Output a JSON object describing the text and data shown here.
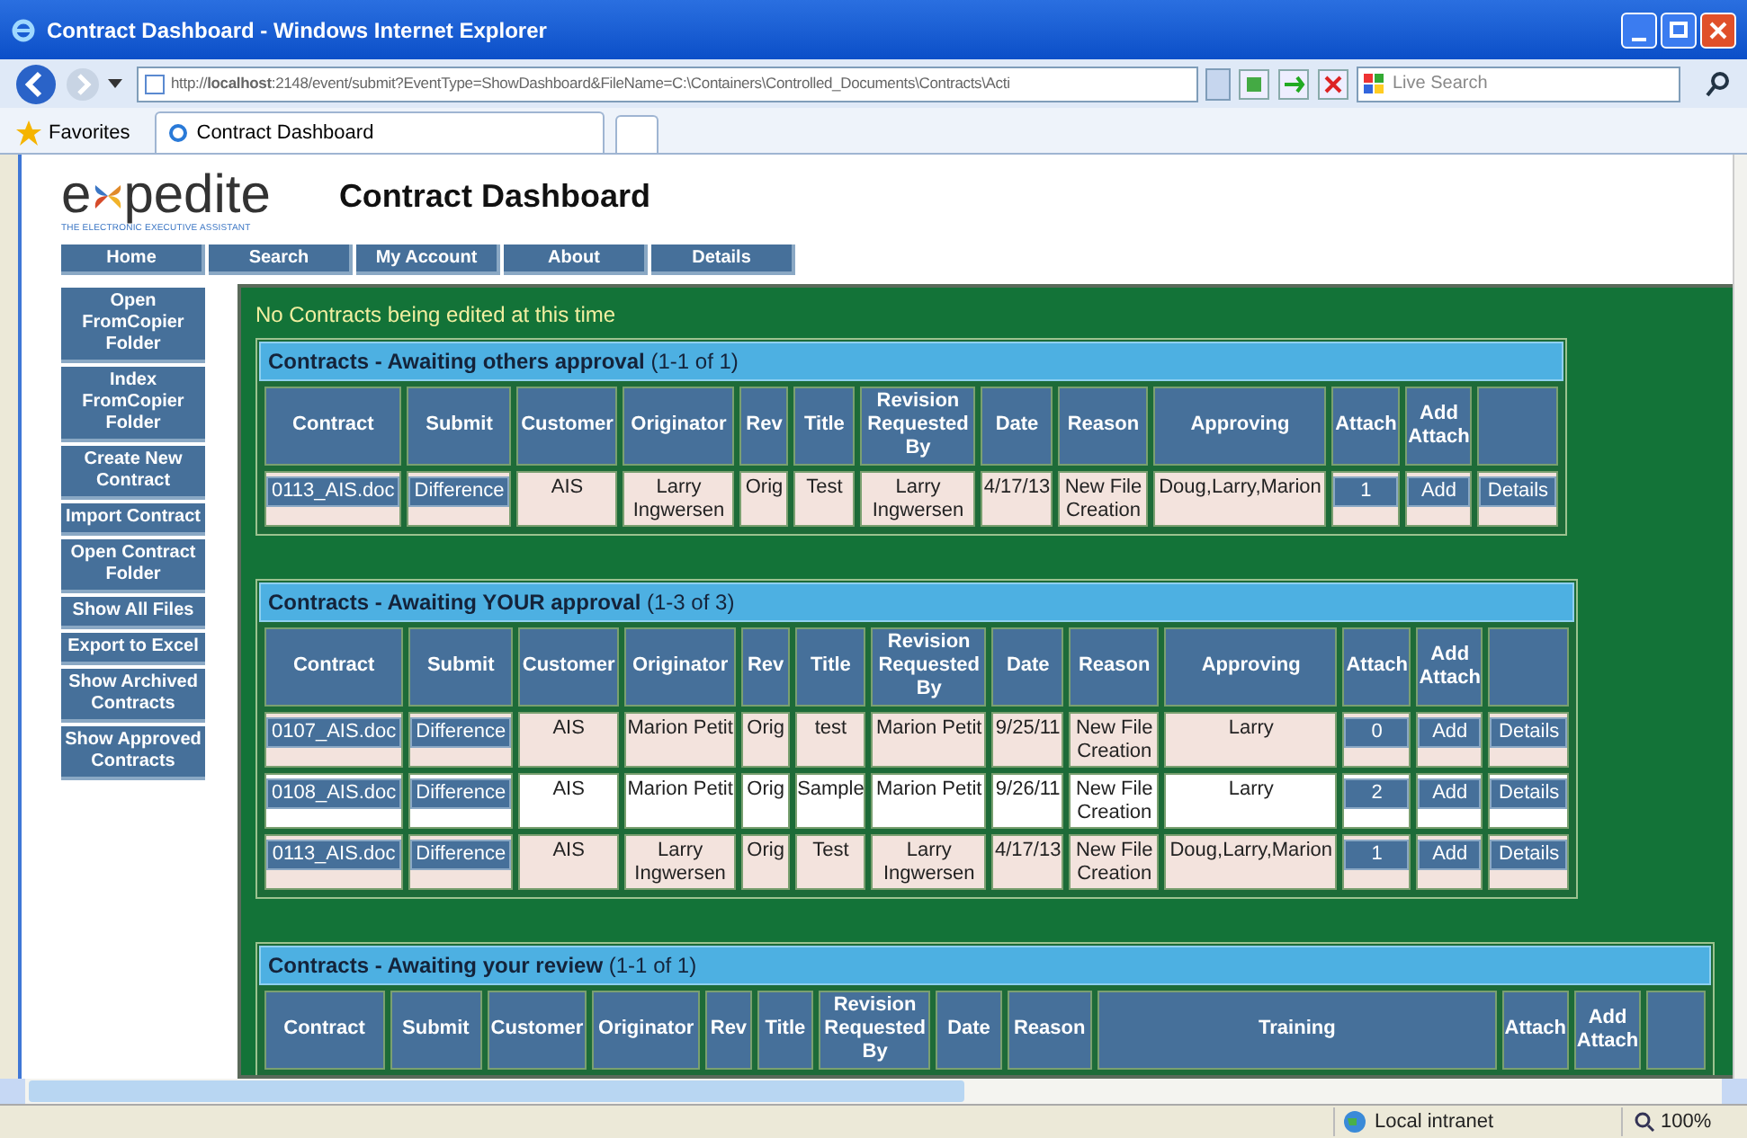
{
  "window": {
    "title": "Contract Dashboard - Windows Internet Explorer"
  },
  "address_bar": {
    "url": "http://**localhost**:2148/event/submit?EventType=ShowDashboard&FileName=C:\\Containers\\Controlled_Documents\\Contracts\\Acti",
    "search_placeholder": "Live Search"
  },
  "favorites": {
    "label": "Favorites"
  },
  "tabs": [
    {
      "label": "Contract Dashboard",
      "selected": true
    }
  ],
  "logo": {
    "before": "e",
    "after": "pedite",
    "tagline": "THE ELECTRONIC EXECUTIVE ASSISTANT"
  },
  "page_title": "Contract Dashboard",
  "nav": [
    "Home",
    "Search",
    "My Account",
    "About",
    "Details"
  ],
  "sidebar": [
    "Open FromCopier Folder",
    "Index FromCopier Folder",
    "Create New Contract",
    "Import Contract",
    "Open Contract Folder",
    "Show All Files",
    "Export to Excel",
    "Show Archived Contracts",
    "Show Approved Contracts"
  ],
  "message": "No Contracts being edited at this time",
  "sections": [
    {
      "title": "Contracts - Awaiting others approval",
      "count": "(1-1 of 1)",
      "columns": [
        "Contract",
        "Submit",
        "Customer",
        "Originator",
        "Rev",
        "Title",
        "Revision Requested By",
        "Date",
        "Reason",
        "Approving",
        "Attach",
        "Add Attach"
      ],
      "rows": [
        [
          {
            "kind": "button",
            "text": "0113_AIS.doc"
          },
          {
            "kind": "button",
            "text": "Difference"
          },
          {
            "kind": "text",
            "text": "AIS"
          },
          {
            "kind": "text",
            "text": "Larry Ingwersen"
          },
          {
            "kind": "text",
            "text": "Orig"
          },
          {
            "kind": "text",
            "text": "Test"
          },
          {
            "kind": "text",
            "text": "Larry Ingwersen"
          },
          {
            "kind": "text",
            "text": "4/17/13"
          },
          {
            "kind": "text",
            "text": "New File Creation"
          },
          {
            "kind": "text",
            "text": "Doug,Larry,Marion"
          },
          {
            "kind": "button",
            "text": "1"
          },
          {
            "kind": "button",
            "text": "Add"
          },
          {
            "kind": "button",
            "text": "Details"
          }
        ]
      ]
    },
    {
      "title": "Contracts - Awaiting YOUR approval",
      "count": "(1-3 of 3)",
      "columns": [
        "Contract",
        "Submit",
        "Customer",
        "Originator",
        "Rev",
        "Title",
        "Revision Requested By",
        "Date",
        "Reason",
        "Approving",
        "Attach",
        "Add Attach"
      ],
      "rows": [
        [
          {
            "kind": "button",
            "text": "0107_AIS.doc"
          },
          {
            "kind": "button",
            "text": "Difference"
          },
          {
            "kind": "text",
            "text": "AIS"
          },
          {
            "kind": "text",
            "text": "Marion Petit"
          },
          {
            "kind": "text",
            "text": "Orig"
          },
          {
            "kind": "text",
            "text": "test"
          },
          {
            "kind": "text",
            "text": "Marion Petit"
          },
          {
            "kind": "text",
            "text": "9/25/11"
          },
          {
            "kind": "text",
            "text": "New File Creation"
          },
          {
            "kind": "text",
            "text": "Larry"
          },
          {
            "kind": "button",
            "text": "0"
          },
          {
            "kind": "button",
            "text": "Add"
          },
          {
            "kind": "button",
            "text": "Details"
          }
        ],
        [
          {
            "kind": "button",
            "text": "0108_AIS.doc"
          },
          {
            "kind": "button",
            "text": "Difference"
          },
          {
            "kind": "text",
            "text": "AIS"
          },
          {
            "kind": "text",
            "text": "Marion Petit"
          },
          {
            "kind": "text",
            "text": "Orig"
          },
          {
            "kind": "text",
            "text": "Sample"
          },
          {
            "kind": "text",
            "text": "Marion Petit"
          },
          {
            "kind": "text",
            "text": "9/26/11"
          },
          {
            "kind": "text",
            "text": "New File Creation"
          },
          {
            "kind": "text",
            "text": "Larry"
          },
          {
            "kind": "button",
            "text": "2"
          },
          {
            "kind": "button",
            "text": "Add"
          },
          {
            "kind": "button",
            "text": "Details"
          }
        ],
        [
          {
            "kind": "button",
            "text": "0113_AIS.doc"
          },
          {
            "kind": "button",
            "text": "Difference"
          },
          {
            "kind": "text",
            "text": "AIS"
          },
          {
            "kind": "text",
            "text": "Larry Ingwersen"
          },
          {
            "kind": "text",
            "text": "Orig"
          },
          {
            "kind": "text",
            "text": "Test"
          },
          {
            "kind": "text",
            "text": "Larry Ingwersen"
          },
          {
            "kind": "text",
            "text": "4/17/13"
          },
          {
            "kind": "text",
            "text": "New File Creation"
          },
          {
            "kind": "text",
            "text": "Doug,Larry,Marion"
          },
          {
            "kind": "button",
            "text": "1"
          },
          {
            "kind": "button",
            "text": "Add"
          },
          {
            "kind": "button",
            "text": "Details"
          }
        ]
      ]
    },
    {
      "title": "Contracts - Awaiting your review",
      "count": "(1-1 of 1)",
      "columns": [
        "Contract",
        "Submit",
        "Customer",
        "Originator",
        "Rev",
        "Title",
        "Revision Requested By",
        "Date",
        "Reason",
        "Training",
        "Attach",
        "Add Attach"
      ]
    }
  ],
  "status_bar": {
    "zone": "Local intranet",
    "zoom": "100%"
  }
}
